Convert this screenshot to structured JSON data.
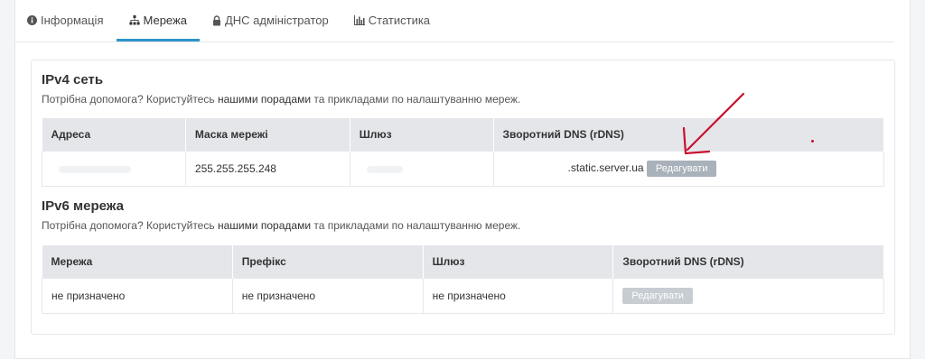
{
  "tabs": [
    {
      "label": "Інформація",
      "icon": "info-icon",
      "active": false
    },
    {
      "label": "Мережа",
      "icon": "network-icon",
      "active": true
    },
    {
      "label": "ДНС адміністратор",
      "icon": "lock-icon",
      "active": false
    },
    {
      "label": "Статистика",
      "icon": "bar-chart-icon",
      "active": false
    }
  ],
  "ipv4": {
    "title": "IPv4 сеть",
    "help_prefix": "Потрібна допомога? Користуйтесь ",
    "help_link": "нашими порадами",
    "help_suffix": " та прикладами по налаштуванню мереж.",
    "headers": [
      "Адреса",
      "Маска мережі",
      "Шлюз",
      "Зворотний DNS (rDNS)"
    ],
    "row": {
      "address": "",
      "mask": "255.255.255.248",
      "gateway": "",
      "rdns": ".static.server.ua",
      "edit_label": "Редагувати"
    }
  },
  "ipv6": {
    "title": "IPv6 мережа",
    "help_prefix": "Потрібна допомога? Користуйтесь ",
    "help_link": "нашими порадами",
    "help_suffix": " та прикладами по налаштуванню мереж.",
    "headers": [
      "Мережа",
      "Префікс",
      "Шлюз",
      "Зворотний DNS (rDNS)"
    ],
    "row": {
      "network": "не призначено",
      "prefix": "не призначено",
      "gateway": "не призначено",
      "edit_label": "Редагувати"
    }
  },
  "colors": {
    "accent": "#2c94c9",
    "annotation": "#c8102e",
    "button": "#a9b1ba"
  }
}
